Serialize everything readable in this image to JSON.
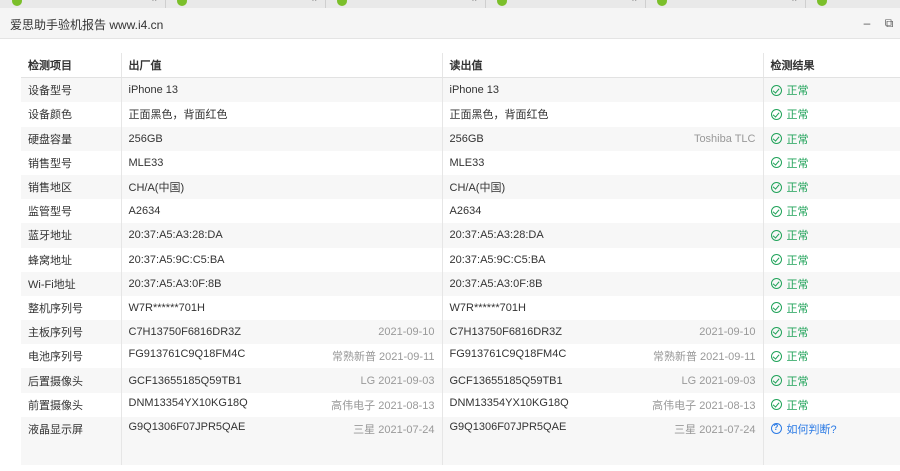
{
  "window": {
    "title": "爱思助手验机报告 www.i4.cn"
  },
  "columns": {
    "item": "检测项目",
    "factory": "出厂值",
    "read": "读出值",
    "result": "检测结果"
  },
  "rows": [
    {
      "item": "设备型号",
      "factory": "iPhone 13",
      "factory_meta": "",
      "read": "iPhone 13",
      "read_meta": "",
      "result": "正常",
      "ok": true
    },
    {
      "item": "设备颜色",
      "factory": "正面黑色，背面红色",
      "factory_meta": "",
      "read": "正面黑色，背面红色",
      "read_meta": "",
      "result": "正常",
      "ok": true
    },
    {
      "item": "硬盘容量",
      "factory": "256GB",
      "factory_meta": "",
      "read": "256GB",
      "read_meta": "Toshiba TLC",
      "result": "正常",
      "ok": true
    },
    {
      "item": "销售型号",
      "factory": "MLE33",
      "factory_meta": "",
      "read": "MLE33",
      "read_meta": "",
      "result": "正常",
      "ok": true
    },
    {
      "item": "销售地区",
      "factory": "CH/A(中国)",
      "factory_meta": "",
      "read": "CH/A(中国)",
      "read_meta": "",
      "result": "正常",
      "ok": true
    },
    {
      "item": "监管型号",
      "factory": "A2634",
      "factory_meta": "",
      "read": "A2634",
      "read_meta": "",
      "result": "正常",
      "ok": true
    },
    {
      "item": "蓝牙地址",
      "factory": "20:37:A5:A3:28:DA",
      "factory_meta": "",
      "read": "20:37:A5:A3:28:DA",
      "read_meta": "",
      "result": "正常",
      "ok": true
    },
    {
      "item": "蜂窝地址",
      "factory": "20:37:A5:9C:C5:BA",
      "factory_meta": "",
      "read": "20:37:A5:9C:C5:BA",
      "read_meta": "",
      "result": "正常",
      "ok": true
    },
    {
      "item": "Wi-Fi地址",
      "factory": "20:37:A5:A3:0F:8B",
      "factory_meta": "",
      "read": "20:37:A5:A3:0F:8B",
      "read_meta": "",
      "result": "正常",
      "ok": true
    },
    {
      "item": "整机序列号",
      "factory": "W7R******701H",
      "factory_meta": "",
      "read": "W7R******701H",
      "read_meta": "",
      "result": "正常",
      "ok": true
    },
    {
      "item": "主板序列号",
      "factory": "C7H13750F6816DR3Z",
      "factory_meta": "2021-09-10",
      "read": "C7H13750F6816DR3Z",
      "read_meta": "2021-09-10",
      "result": "正常",
      "ok": true
    },
    {
      "item": "电池序列号",
      "factory": "FG913761C9Q18FM4C",
      "factory_meta": "常熟新普 2021-09-11",
      "read": "FG913761C9Q18FM4C",
      "read_meta": "常熟新普 2021-09-11",
      "result": "正常",
      "ok": true
    },
    {
      "item": "后置摄像头",
      "factory": "GCF13655185Q59TB1",
      "factory_meta": "LG 2021-09-03",
      "read": "GCF13655185Q59TB1",
      "read_meta": "LG 2021-09-03",
      "result": "正常",
      "ok": true
    },
    {
      "item": "前置摄像头",
      "factory": "DNM13354YX10KG18Q",
      "factory_meta": "高伟电子 2021-08-13",
      "read": "DNM13354YX10KG18Q",
      "read_meta": "高伟电子 2021-08-13",
      "result": "正常",
      "ok": true
    },
    {
      "item": "液晶显示屏",
      "factory": "G9Q1306F07JPR5QAE",
      "factory_meta": "三星 2021-07-24",
      "read": "G9Q1306F07JPR5QAE",
      "read_meta": "三星 2021-07-24",
      "result": "如何判断?",
      "ok": false
    }
  ]
}
